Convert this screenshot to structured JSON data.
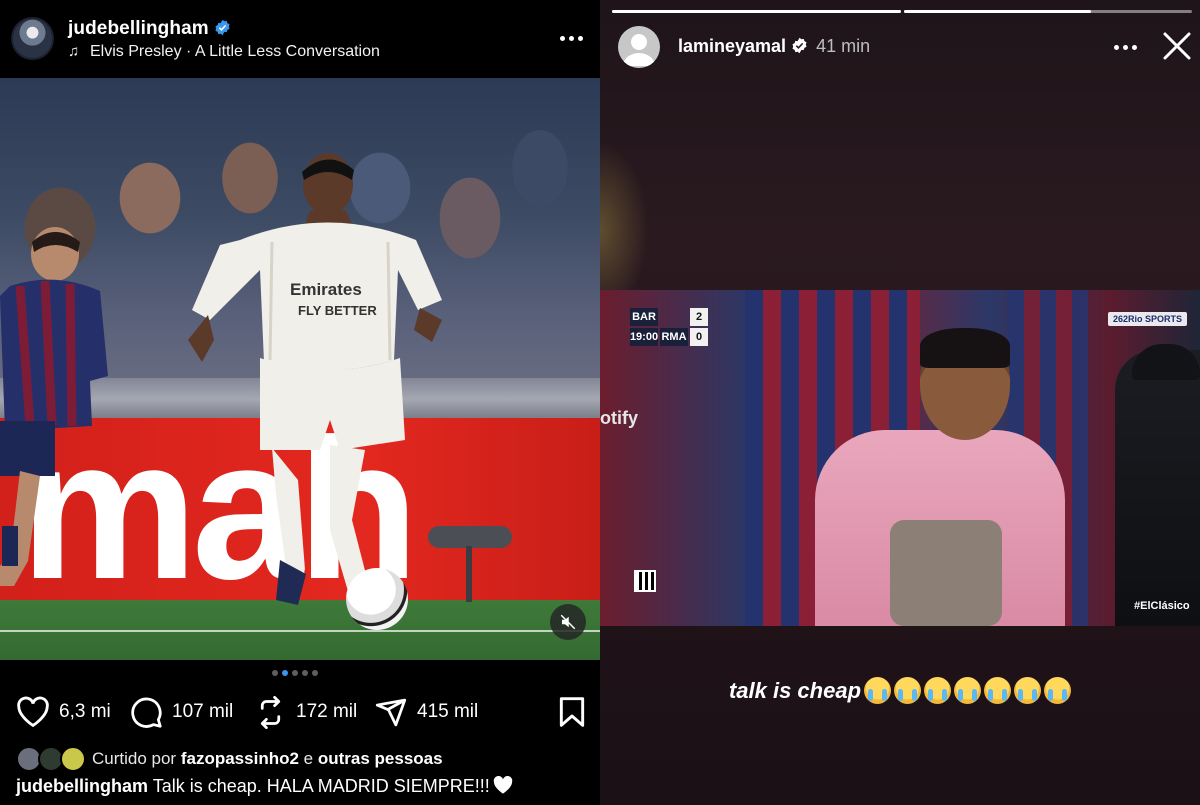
{
  "post": {
    "username": "judebellingham",
    "music": "Elvis Presley · A Little Less Conversation",
    "photo_ad_text": "mah",
    "carousel": {
      "count": 5,
      "active_index": 1
    },
    "actions": {
      "likes": "6,3 mi",
      "comments": "107 mil",
      "reposts": "172 mil",
      "shares": "415 mil"
    },
    "liked_by": {
      "prefix": "Curtido por",
      "user": "fazopassinho2",
      "connector": "e",
      "suffix": "outras pessoas"
    },
    "caption": {
      "user": "judebellingham",
      "text": "Talk is cheap. HALA MADRID SIEMPRE!!!"
    },
    "colors": {
      "verified": "#3897f0",
      "active_dot": "#3897f0"
    }
  },
  "story": {
    "username": "lamineyamal",
    "time": "41 min",
    "progress": [
      1.0,
      0.65
    ],
    "scoreboard": {
      "team1": "BAR",
      "team2": "RMA",
      "score1": "2",
      "score2": "0",
      "clock": "19:00"
    },
    "channel_logo": "262Rio SPORTS",
    "hashtag": "#ElClásico",
    "sponsor_text": "otify",
    "caption": "talk is cheap",
    "emoji_count": 7
  }
}
